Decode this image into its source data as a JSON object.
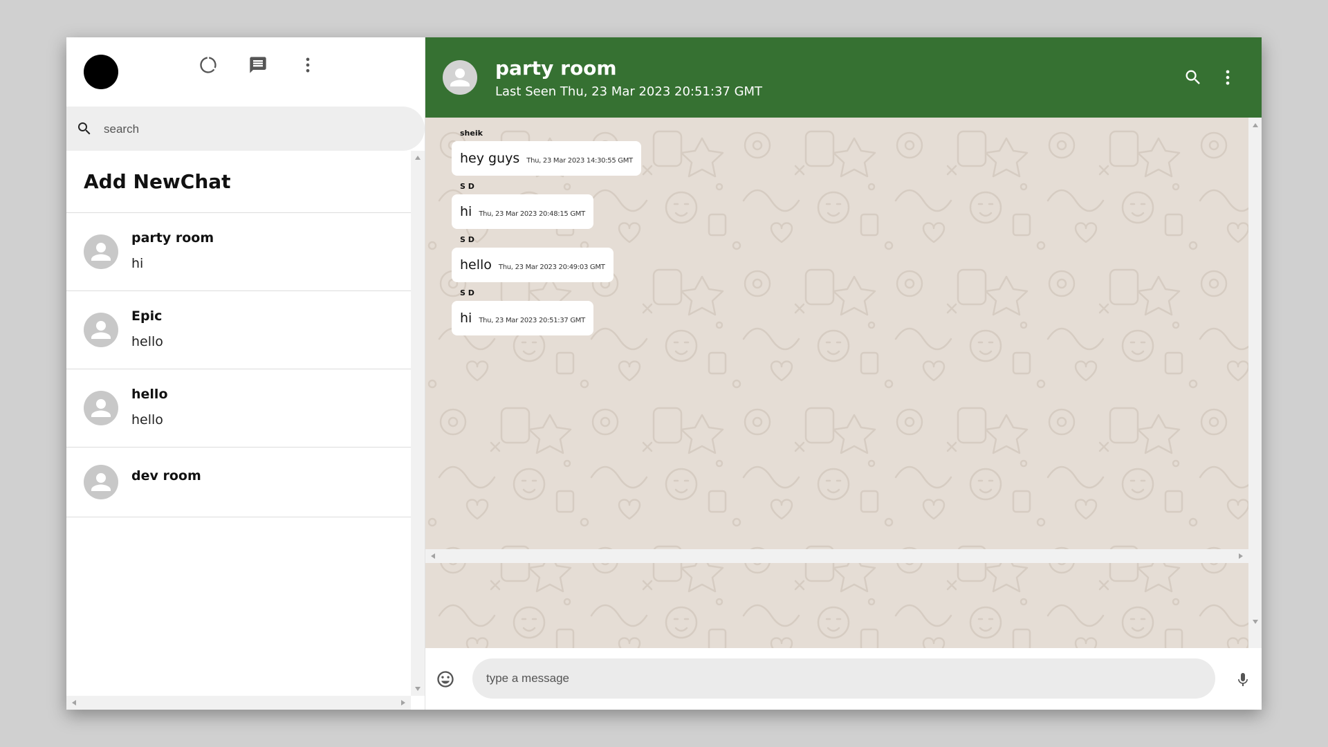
{
  "sidebar": {
    "search_placeholder": "search",
    "add_new_chat": "Add NewChat",
    "chats": [
      {
        "name": "party room",
        "last_message": "hi"
      },
      {
        "name": "Epic",
        "last_message": "hello"
      },
      {
        "name": "hello",
        "last_message": "hello"
      },
      {
        "name": "dev room",
        "last_message": ""
      }
    ]
  },
  "chat": {
    "room_name": "party room",
    "last_seen": "Last Seen Thu, 23 Mar 2023 20:51:37 GMT",
    "messages": [
      {
        "sender": "sheik",
        "text": "hey guys",
        "time": "Thu, 23 Mar 2023 14:30:55 GMT"
      },
      {
        "sender": "S D",
        "text": "hi",
        "time": "Thu, 23 Mar 2023 20:48:15 GMT"
      },
      {
        "sender": "S D",
        "text": "hello",
        "time": "Thu, 23 Mar 2023 20:49:03 GMT"
      },
      {
        "sender": "S D",
        "text": "hi",
        "time": "Thu, 23 Mar 2023 20:51:37 GMT"
      }
    ],
    "composer_placeholder": "type a message"
  },
  "icons": {
    "status": "status-icon",
    "new_chat": "chat-icon",
    "menu": "more-vert-icon",
    "search": "search-icon",
    "emoji": "emoji-icon",
    "mic": "mic-icon",
    "avatar": "person-icon"
  },
  "colors": {
    "header_green": "#367132",
    "chat_background": "#e5ddd5",
    "bubble": "#ffffff",
    "search_background": "#eeeeee"
  }
}
